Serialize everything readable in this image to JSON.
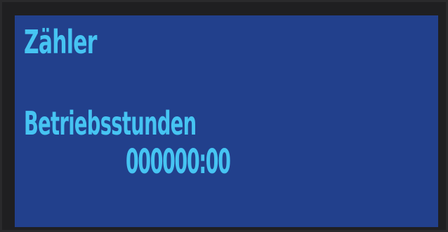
{
  "display": {
    "title": "Zähler",
    "counter_label": "Betriebsstunden",
    "counter_value": "000000:00"
  },
  "colors": {
    "screen_background": "#22408c",
    "text": "#46c4f2",
    "frame": "#1f1f21"
  }
}
